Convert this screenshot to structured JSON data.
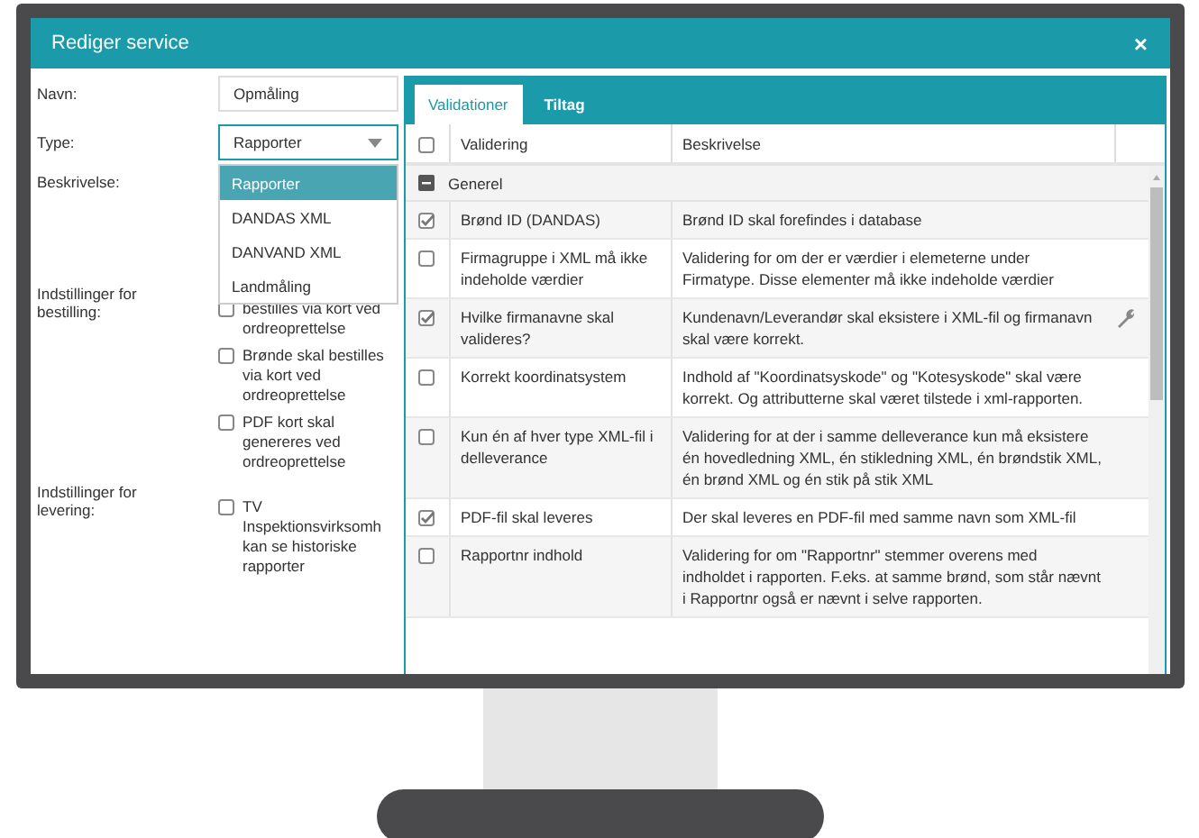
{
  "window": {
    "title": "Rediger service",
    "close": "×"
  },
  "name_field": {
    "label": "Navn:",
    "value": "Opmåling"
  },
  "type_field": {
    "label": "Type:",
    "value": "Rapporter",
    "expanded": true,
    "options": [
      {
        "label": "Rapporter",
        "selected": true
      },
      {
        "label": "DANDAS XML",
        "selected": false
      },
      {
        "label": "DANVAND XML",
        "selected": false
      },
      {
        "label": "Landmåling",
        "selected": false
      }
    ]
  },
  "description_label": "Beskrivelse:",
  "settings": [
    {
      "label": "Indstillinger for bestilling:",
      "items": [
        {
          "text": "bestilles via kort ved ordreoprettelse",
          "checked": false
        },
        {
          "text": "Brønde skal bestilles via kort ved ordreoprettelse",
          "checked": false
        },
        {
          "text": "PDF kort skal genereres ved ordreoprettelse",
          "checked": false
        }
      ]
    },
    {
      "label": "Indstillinger for levering:",
      "items": [
        {
          "text": "TV Inspektionsvirksomh kan se historiske rapporter",
          "checked": false
        }
      ]
    }
  ],
  "tabs": [
    {
      "label": "Validationer",
      "selected": true
    },
    {
      "label": "Tiltag",
      "selected": false
    }
  ],
  "table": {
    "select_all": false,
    "columns": [
      "Validering",
      "Beskrivelse"
    ],
    "group": {
      "label": "Generel",
      "expanded": true
    },
    "rows": [
      {
        "name": "Brønd ID (DANDAS)",
        "description": "Brønd ID skal forefindes i database",
        "checked": true,
        "tool": false
      },
      {
        "name": "Firmagruppe i XML må ikke indeholde værdier",
        "description": "Validering for om der er værdier i elemeterne under Firmatype. Disse elementer må ikke indeholde værdier",
        "checked": false,
        "tool": false
      },
      {
        "name": "Hvilke firmanavne skal valideres?",
        "description": "Kundenavn/Leverandør skal eksistere i XML-fil og firmanavn skal være korrekt.",
        "checked": true,
        "tool": true
      },
      {
        "name": "Korrekt koordinatsystem",
        "description": "Indhold af \"Koordinatsyskode\" og \"Kotesyskode\" skal være korrekt. Og attributterne skal været tilstede i xml-rapporten.",
        "checked": false,
        "tool": false
      },
      {
        "name": "Kun én af hver type XML-fil i delleverance",
        "description": "Validering for at der i samme delleverance kun må eksistere én hovedledning XML, én stikledning XML, én brøndstik XML, én brønd XML og én stik på stik XML",
        "checked": false,
        "tool": false
      },
      {
        "name": "PDF-fil skal leveres",
        "description": "Der skal leveres en PDF-fil med samme navn som XML-fil",
        "checked": true,
        "tool": false
      },
      {
        "name": "Rapportnr indhold",
        "description": "Validering for om \"Rapportnr\" stemmer overens med indholdet i rapporten. F.eks. at samme brønd, som står nævnt i Rapportnr også er nævnt i selve rapporten.",
        "checked": false,
        "tool": false
      }
    ]
  }
}
